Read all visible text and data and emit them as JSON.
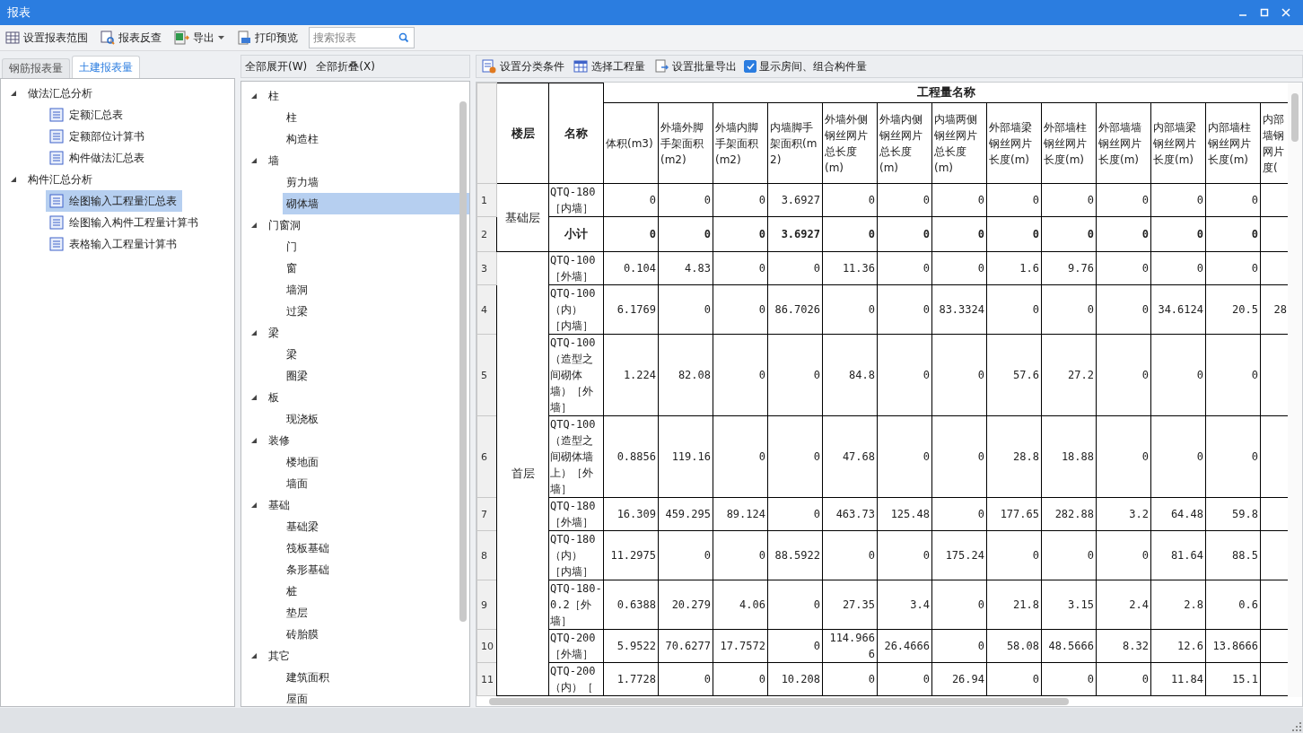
{
  "window": {
    "title": "报表"
  },
  "toolbar": {
    "buttons": [
      {
        "kind": "range",
        "label": "设置报表范围"
      },
      {
        "kind": "check",
        "label": "报表反查"
      },
      {
        "kind": "export",
        "label": "导出"
      },
      {
        "kind": "print",
        "label": "打印预览"
      }
    ],
    "search": {
      "placeholder": "搜索报表"
    }
  },
  "tabs": [
    {
      "label": "钢筋报表量",
      "selected": false
    },
    {
      "label": "土建报表量",
      "selected": true
    }
  ],
  "report_tree": [
    {
      "label": "做法汇总分析",
      "expanded": true,
      "children": [
        {
          "label": "定额汇总表",
          "selected": false
        },
        {
          "label": "定额部位计算书",
          "selected": false
        },
        {
          "label": "构件做法汇总表",
          "selected": false
        }
      ]
    },
    {
      "label": "构件汇总分析",
      "expanded": true,
      "children": [
        {
          "label": "绘图输入工程量汇总表",
          "selected": true
        },
        {
          "label": "绘图输入构件工程量计算书",
          "selected": false
        },
        {
          "label": "表格输入工程量计算书",
          "selected": false
        }
      ]
    }
  ],
  "component_panel": {
    "actions": [
      "全部展开(W)",
      "全部折叠(X)"
    ],
    "tree": [
      {
        "label": "柱",
        "expanded": true,
        "children": [
          {
            "label": "柱",
            "selected": false
          },
          {
            "label": "构造柱",
            "selected": false
          }
        ]
      },
      {
        "label": "墙",
        "expanded": true,
        "children": [
          {
            "label": "剪力墙",
            "selected": false
          },
          {
            "label": "砌体墙",
            "selected": true
          }
        ]
      },
      {
        "label": "门窗洞",
        "expanded": true,
        "children": [
          {
            "label": "门",
            "selected": false
          },
          {
            "label": "窗",
            "selected": false
          },
          {
            "label": "墙洞",
            "selected": false
          },
          {
            "label": "过梁",
            "selected": false
          }
        ]
      },
      {
        "label": "梁",
        "expanded": true,
        "children": [
          {
            "label": "梁",
            "selected": false
          },
          {
            "label": "圈梁",
            "selected": false
          }
        ]
      },
      {
        "label": "板",
        "expanded": true,
        "children": [
          {
            "label": "现浇板",
            "selected": false
          }
        ]
      },
      {
        "label": "装修",
        "expanded": true,
        "children": [
          {
            "label": "楼地面",
            "selected": false
          },
          {
            "label": "墙面",
            "selected": false
          }
        ]
      },
      {
        "label": "基础",
        "expanded": true,
        "children": [
          {
            "label": "基础梁",
            "selected": false
          },
          {
            "label": "筏板基础",
            "selected": false
          },
          {
            "label": "条形基础",
            "selected": false
          },
          {
            "label": "桩",
            "selected": false
          },
          {
            "label": "垫层",
            "selected": false
          },
          {
            "label": "砖胎膜",
            "selected": false
          }
        ]
      },
      {
        "label": "其它",
        "expanded": true,
        "children": [
          {
            "label": "建筑面积",
            "selected": false
          },
          {
            "label": "屋面",
            "selected": false
          }
        ]
      }
    ]
  },
  "grid_toolbar": {
    "buttons": [
      {
        "kind": "classify",
        "label": "设置分类条件"
      },
      {
        "kind": "select",
        "label": "选择工程量"
      },
      {
        "kind": "batch",
        "label": "设置批量导出"
      }
    ],
    "checkbox": {
      "label": "显示房间、组合构件量",
      "checked": true
    }
  },
  "table": {
    "floor_header": "楼层",
    "name_header": "名称",
    "group_header": "工程量名称",
    "columns": [
      "体积(m3)",
      "外墙外脚手架面积(m2)",
      "外墙内脚手架面积(m2)",
      "内墙脚手架面积(m2)",
      "外墙外侧钢丝网片总长度(m)",
      "外墙内侧钢丝网片总长度(m)",
      "内墙两侧钢丝网片总长度(m)",
      "外部墙梁钢丝网片长度(m)",
      "外部墙柱钢丝网片长度(m)",
      "外部墙墙钢丝网片长度(m)",
      "内部墙梁钢丝网片长度(m)",
      "内部墙柱钢丝网片长度(m)",
      "内部墙钢网片度("
    ],
    "floors": [
      {
        "name": "基础层",
        "rows": [
          {
            "no": "1",
            "name": "QTQ-180［内墙］",
            "subtotal": false,
            "values": [
              "0",
              "0",
              "0",
              "3.6927",
              "0",
              "0",
              "0",
              "0",
              "0",
              "0",
              "0",
              "0"
            ]
          },
          {
            "no": "2",
            "name": "小计",
            "subtotal": true,
            "values": [
              "0",
              "0",
              "0",
              "3.6927",
              "0",
              "0",
              "0",
              "0",
              "0",
              "0",
              "0",
              "0"
            ]
          }
        ]
      },
      {
        "name": "首层",
        "rows": [
          {
            "no": "3",
            "name": "QTQ-100［外墙］",
            "subtotal": false,
            "values": [
              "0.104",
              "4.83",
              "0",
              "0",
              "11.36",
              "0",
              "0",
              "1.6",
              "9.76",
              "0",
              "0",
              "0"
            ]
          },
          {
            "no": "4",
            "name": "QTQ-100（内）［内墙］",
            "subtotal": false,
            "values": [
              "6.1769",
              "0",
              "0",
              "86.7026",
              "0",
              "0",
              "83.3324",
              "0",
              "0",
              "0",
              "34.6124",
              "20.5",
              "28"
            ]
          },
          {
            "no": "5",
            "name": "QTQ-100（造型之间砌体墙）［外墙］",
            "subtotal": false,
            "values": [
              "1.224",
              "82.08",
              "0",
              "0",
              "84.8",
              "0",
              "0",
              "57.6",
              "27.2",
              "0",
              "0",
              "0"
            ]
          },
          {
            "no": "6",
            "name": "QTQ-100（造型之间砌体墙上）［外墙］",
            "subtotal": false,
            "values": [
              "0.8856",
              "119.16",
              "0",
              "0",
              "47.68",
              "0",
              "0",
              "28.8",
              "18.88",
              "0",
              "0",
              "0"
            ]
          },
          {
            "no": "7",
            "name": "QTQ-180［外墙］",
            "subtotal": false,
            "values": [
              "16.309",
              "459.295",
              "89.124",
              "0",
              "463.73",
              "125.48",
              "0",
              "177.65",
              "282.88",
              "3.2",
              "64.48",
              "59.8"
            ]
          },
          {
            "no": "8",
            "name": "QTQ-180（内）［内墙］",
            "subtotal": false,
            "values": [
              "11.2975",
              "0",
              "0",
              "88.5922",
              "0",
              "0",
              "175.24",
              "0",
              "0",
              "0",
              "81.64",
              "88.5"
            ]
          },
          {
            "no": "9",
            "name": "QTQ-180-0.2［外墙］",
            "subtotal": false,
            "values": [
              "0.6388",
              "20.279",
              "4.06",
              "0",
              "27.35",
              "3.4",
              "0",
              "21.8",
              "3.15",
              "2.4",
              "2.8",
              "0.6"
            ]
          },
          {
            "no": "10",
            "name": "QTQ-200［外墙］",
            "subtotal": false,
            "values": [
              "5.9522",
              "70.6277",
              "17.7572",
              "0",
              "114.9666",
              "26.4666",
              "0",
              "58.08",
              "48.5666",
              "8.32",
              "12.6",
              "13.8666"
            ]
          },
          {
            "no": "11",
            "name": "QTQ-200（内）［",
            "subtotal": false,
            "values": [
              "1.7728",
              "0",
              "0",
              "10.208",
              "0",
              "0",
              "26.94",
              "0",
              "0",
              "0",
              "11.84",
              "15.1"
            ]
          }
        ]
      }
    ]
  }
}
